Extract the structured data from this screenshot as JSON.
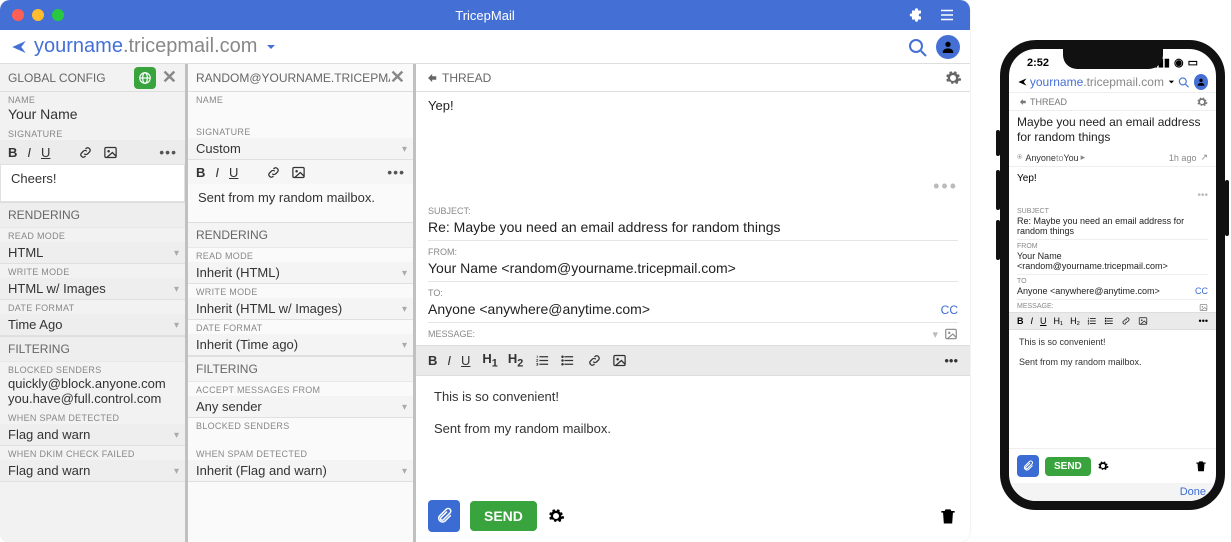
{
  "window": {
    "title": "TricepMail",
    "url_user": "yourname",
    "url_domain": ".tricepmail.com"
  },
  "pane_global": {
    "title": "GLOBAL CONFIG",
    "name_label": "NAME",
    "name_value": "Your Name",
    "signature_label": "SIGNATURE",
    "signature_text": "Cheers!",
    "rendering_title": "RENDERING",
    "read_mode_label": "READ MODE",
    "read_mode_value": "HTML",
    "write_mode_label": "WRITE MODE",
    "write_mode_value": "HTML w/ Images",
    "date_format_label": "DATE FORMAT",
    "date_format_value": "Time Ago",
    "filtering_title": "FILTERING",
    "blocked_label": "BLOCKED SENDERS",
    "blocked_1": "quickly@block.anyone.com",
    "blocked_2": "you.have@full.control.com",
    "spam_label": "WHEN SPAM DETECTED",
    "spam_value": "Flag and warn",
    "dkim_label": "WHEN DKIM CHECK FAILED",
    "dkim_value": "Flag and warn"
  },
  "pane_mailbox": {
    "title": "RANDOM@YOURNAME.TRICEPMA",
    "name_label": "NAME",
    "signature_label": "SIGNATURE",
    "signature_mode": "Custom",
    "signature_text": "Sent from my random mailbox.",
    "rendering_title": "RENDERING",
    "read_mode_label": "READ MODE",
    "read_mode_value": "Inherit (HTML)",
    "write_mode_label": "WRITE MODE",
    "write_mode_value": "Inherit (HTML w/ Images)",
    "date_format_label": "DATE FORMAT",
    "date_format_value": "Inherit (Time ago)",
    "filtering_title": "FILTERING",
    "accept_label": "ACCEPT MESSAGES FROM",
    "accept_value": "Any sender",
    "blocked_label": "BLOCKED SENDERS",
    "spam_label": "WHEN SPAM DETECTED",
    "spam_value": "Inherit (Flag and warn)"
  },
  "thread": {
    "title": "THREAD",
    "body": "Yep!",
    "compose": {
      "subject_label": "SUBJECT:",
      "subject_value": "Re: Maybe you need an email address for random things",
      "from_label": "FROM:",
      "from_value": "Your Name <random@yourname.tricepmail.com>",
      "to_label": "TO:",
      "to_value": "Anyone <anywhere@anytime.com>",
      "cc_label": "CC",
      "message_label": "MESSAGE:",
      "message_line1": "This is so convenient!",
      "message_line2": "Sent from my random mailbox.",
      "send_label": "SEND"
    }
  },
  "phone": {
    "time": "2:52",
    "url_user": "yourname",
    "url_domain": ".tricepmail.com",
    "thread_title": "THREAD",
    "subject_display": "Maybe you need an email address for random things",
    "meta_from": "Anyone",
    "meta_mid": " to ",
    "meta_to": "You",
    "meta_time": "1h ago",
    "body": "Yep!",
    "compose": {
      "subject_label": "SUBJECT",
      "subject_value": "Re: Maybe you need an email address for random things",
      "from_label": "FROM",
      "from_value": "Your Name <random@yourname.tricepmail.com>",
      "to_label": "TO",
      "to_value": "Anyone <anywhere@anytime.com>",
      "cc_label": "CC",
      "message_label": "MESSAGE:",
      "message_line1": "This is so convenient!",
      "message_line2": "Sent from my random mailbox.",
      "send_label": "SEND"
    },
    "done_label": "Done"
  }
}
